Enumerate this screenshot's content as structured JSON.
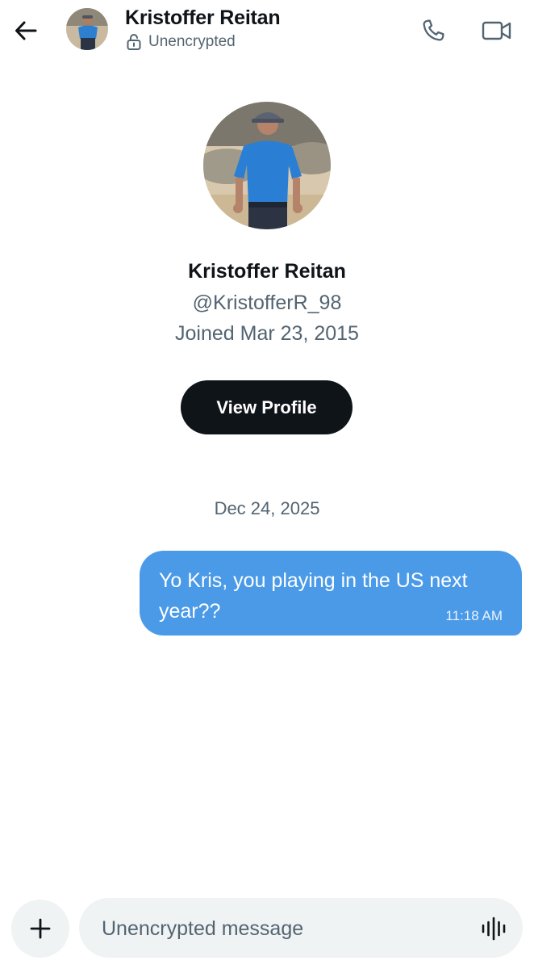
{
  "header": {
    "name": "Kristoffer Reitan",
    "status": "Unencrypted",
    "icons": {
      "back": "arrow-left-icon",
      "status": "unlocked-padlock-icon",
      "call": "phone-icon",
      "video": "video-camera-icon"
    }
  },
  "profile": {
    "name": "Kristoffer Reitan",
    "handle": "@KristofferR_98",
    "joined": "Joined Mar 23, 2015",
    "view_profile_label": "View Profile"
  },
  "conversation": {
    "date_separator": "Dec 24, 2025",
    "messages": [
      {
        "text": "Yo Kris, you playing in the US next year??",
        "time": "11:18 AM",
        "direction": "outgoing"
      }
    ]
  },
  "composer": {
    "placeholder": "Unencrypted message",
    "icons": {
      "add": "plus-icon",
      "voice": "voice-waveform-icon"
    }
  },
  "colors": {
    "accent_bubble": "#4a9ae8",
    "button_dark": "#0f1419",
    "secondary_text": "#536471",
    "field_background": "#eff3f4"
  }
}
